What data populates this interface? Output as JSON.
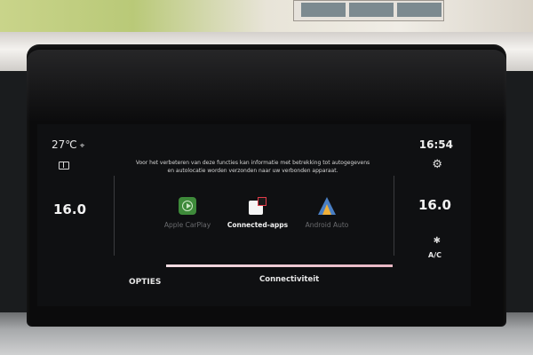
{
  "status": {
    "outside_temp": "27℃",
    "clock": "16:54"
  },
  "climate": {
    "left_temp": "16.0",
    "right_temp": "16.0",
    "ac_label": "A/C"
  },
  "info_text": "Voor het verbeteren van deze functies kan informatie met betrekking tot autogegevens en autolocatie worden verzonden naar uw verbonden apparaat.",
  "apps": [
    {
      "label": "Apple CarPlay",
      "active": false,
      "color": "#3e8a3a"
    },
    {
      "label": "Connected-apps",
      "active": true,
      "color": "#e23b4a"
    },
    {
      "label": "Android Auto",
      "active": false,
      "color": "#4a7fc4"
    }
  ],
  "progress": 1.0,
  "footer": {
    "options_label": "OPTIES",
    "section_title": "Connectiviteit"
  },
  "icons": {
    "location": "location-pin-icon",
    "manual": "book-icon",
    "settings": "gear-icon",
    "fan": "fan-icon"
  }
}
